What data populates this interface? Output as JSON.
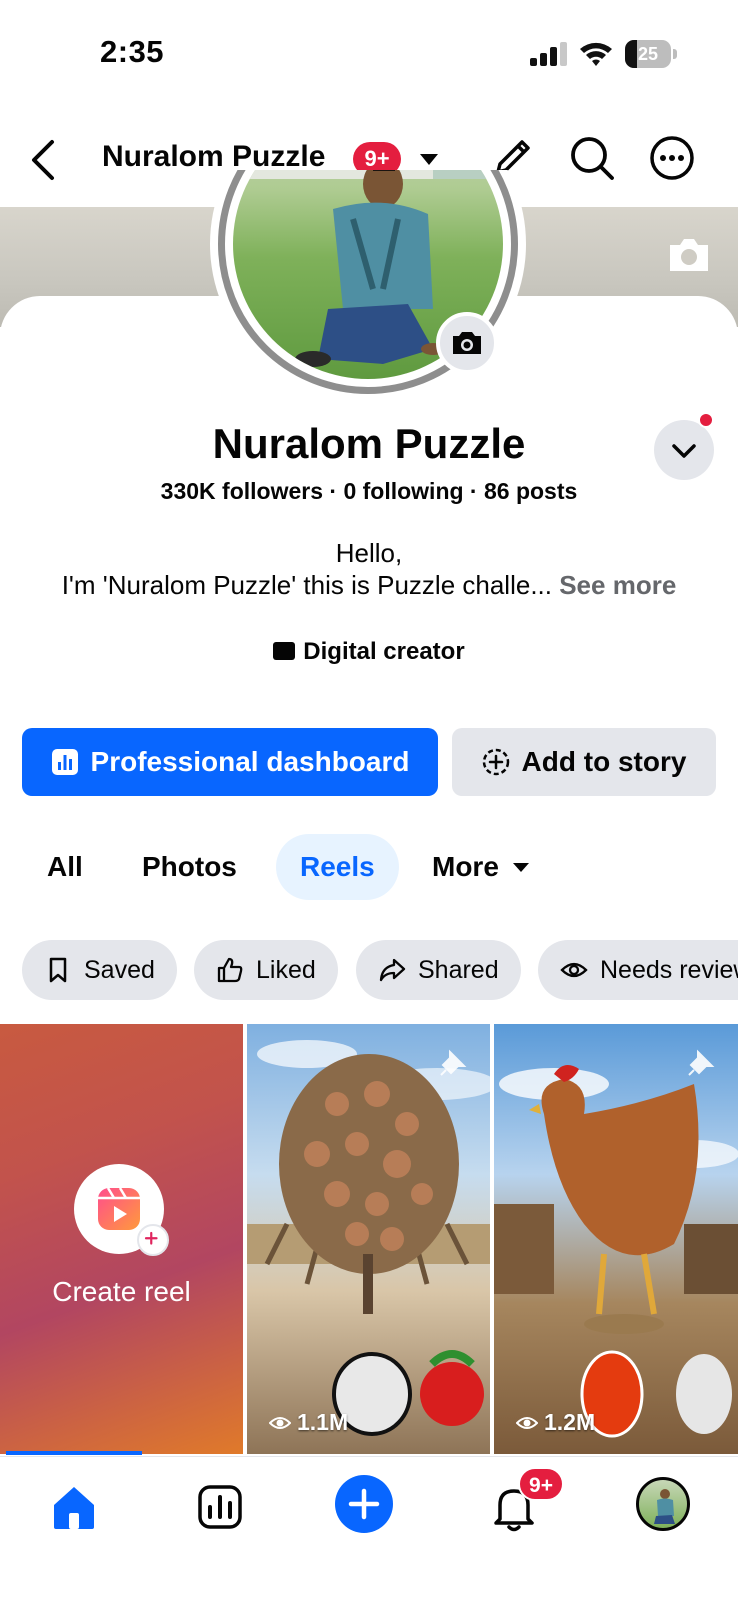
{
  "status_bar": {
    "time": "2:35",
    "battery": "25",
    "battery_level": 0.25
  },
  "header": {
    "title": "Nuralom Puzzle",
    "notification_badge": "9+"
  },
  "profile": {
    "name": "Nuralom Puzzle",
    "stats": "330K followers · 0 following · 86 posts",
    "bio_line1": "Hello,",
    "bio_line2": "I'm 'Nuralom Puzzle' this is Puzzle challe...",
    "see_more": "See more",
    "category": "Digital creator"
  },
  "actions": {
    "dashboard_label": "Professional dashboard",
    "story_label": "Add to story"
  },
  "tabs": [
    {
      "label": "All"
    },
    {
      "label": "Photos"
    },
    {
      "label": "Reels",
      "active": true
    },
    {
      "label": "More"
    }
  ],
  "filters": [
    {
      "label": "Saved",
      "icon": "bookmark-icon"
    },
    {
      "label": "Liked",
      "icon": "thumbs-up-icon"
    },
    {
      "label": "Shared",
      "icon": "share-icon"
    },
    {
      "label": "Needs review",
      "icon": "eye-icon"
    }
  ],
  "reels": {
    "create_label": "Create reel",
    "items": [
      {
        "views": "1.1M"
      },
      {
        "views": "1.2M"
      }
    ]
  },
  "bottom_nav": {
    "notifications_badge": "9+"
  },
  "colors": {
    "brand_blue": "#0866ff",
    "badge_red": "#e41e3f",
    "chip_gray": "#e4e6eb"
  }
}
